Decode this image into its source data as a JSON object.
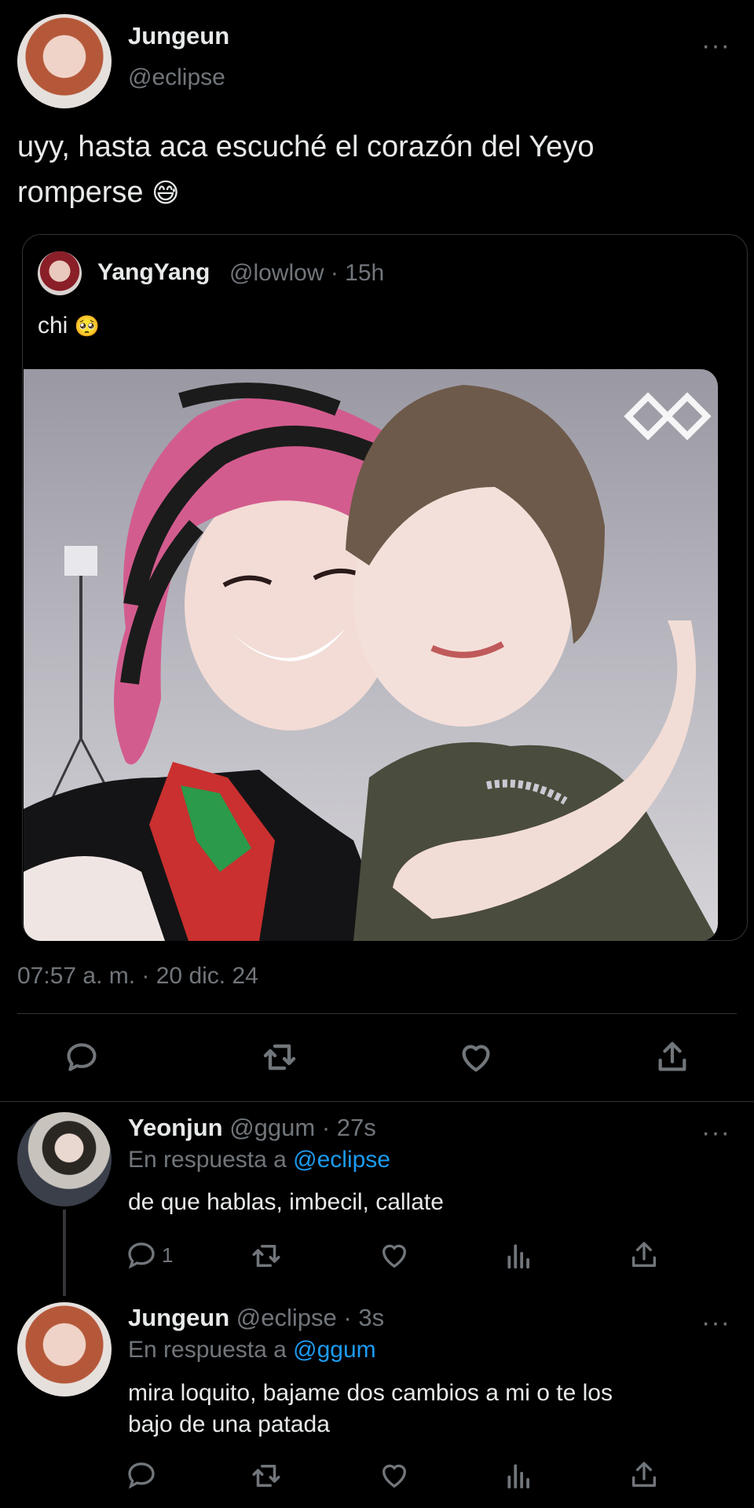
{
  "main_tweet": {
    "name": "Jungeun",
    "handle": "@eclipse",
    "more": "···",
    "text_line1": "uyy, hasta aca escuché el corazón del Yeyo",
    "text_line2": "romperse",
    "emoji": "😅",
    "timestamp": "07:57 a. m. · 20 dic. 24"
  },
  "quoted_tweet": {
    "name": "YangYang",
    "handle": "@lowlow",
    "time": "· 15h",
    "text": "chi",
    "emoji": "🥺"
  },
  "replies": [
    {
      "name": "Yeonjun",
      "handle": "@ggum",
      "time": "· 27s",
      "reply_prefix": "En respuesta a",
      "reply_to": "@eclipse",
      "text_line1": "de que hablas, imbecil, callate",
      "text_line2": "",
      "reply_count": "1",
      "more": "···"
    },
    {
      "name": "Jungeun",
      "handle": "@eclipse",
      "time": "· 3s",
      "reply_prefix": "En respuesta a",
      "reply_to": "@ggum",
      "text_line1": "mira loquito, bajame dos cambios a mi o te los",
      "text_line2": "bajo de una patada",
      "reply_count": "",
      "more": "···"
    }
  ],
  "icons": [
    "reply-icon",
    "retweet-icon",
    "like-icon",
    "share-icon",
    "views-icon",
    "more-icon"
  ],
  "colors": {
    "background": "#000000",
    "text": "#e7e9ea",
    "muted": "#71767b",
    "link": "#1d9bf0",
    "divider": "#2f3336"
  }
}
